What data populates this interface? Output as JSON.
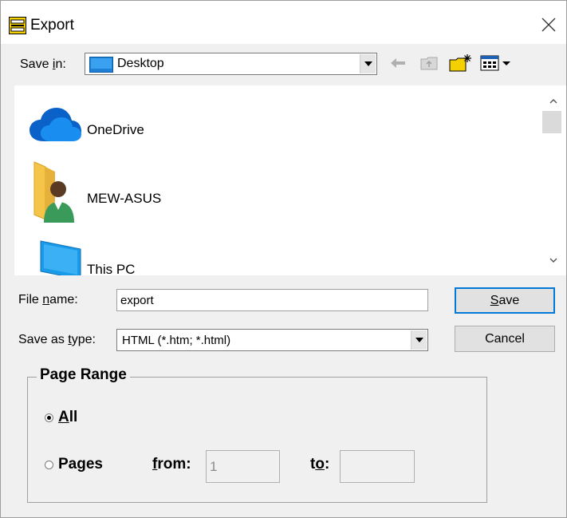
{
  "window": {
    "title": "Export",
    "close_glyph": "✕"
  },
  "save_in": {
    "label_pre": "Save ",
    "label_u": "i",
    "label_post": "n:",
    "value": "Desktop"
  },
  "toolbar": {
    "icons": [
      "back-icon",
      "up-folder-icon",
      "new-folder-icon",
      "view-menu-icon"
    ]
  },
  "file_list": {
    "items": [
      {
        "label": "OneDrive",
        "icon": "onedrive-cloud-icon"
      },
      {
        "label": "MEW-ASUS",
        "icon": "user-folder-icon"
      },
      {
        "label": "This PC",
        "icon": "this-pc-icon"
      }
    ]
  },
  "file_name": {
    "label_pre": "File ",
    "label_u": "n",
    "label_post": "ame:",
    "value": "export"
  },
  "save_as_type": {
    "label_pre": "Save as ",
    "label_u": "t",
    "label_post": "ype:",
    "value": "HTML (*.htm; *.html)"
  },
  "buttons": {
    "save_u": "S",
    "save_rest": "ave",
    "cancel": "Cancel"
  },
  "page_range": {
    "title": "Page Range",
    "all_u": "A",
    "all_rest": "ll",
    "pages_pre": "Pa",
    "pages_u": "g",
    "pages_post": "es",
    "from_u": "f",
    "from_rest": "rom:",
    "to_pre": "t",
    "to_u": "o",
    "to_post": ":",
    "from_value": "1",
    "to_value": "",
    "selected": "All"
  },
  "colors": {
    "accent": "#0078d7",
    "dialog_bg": "#f0f0f0"
  }
}
